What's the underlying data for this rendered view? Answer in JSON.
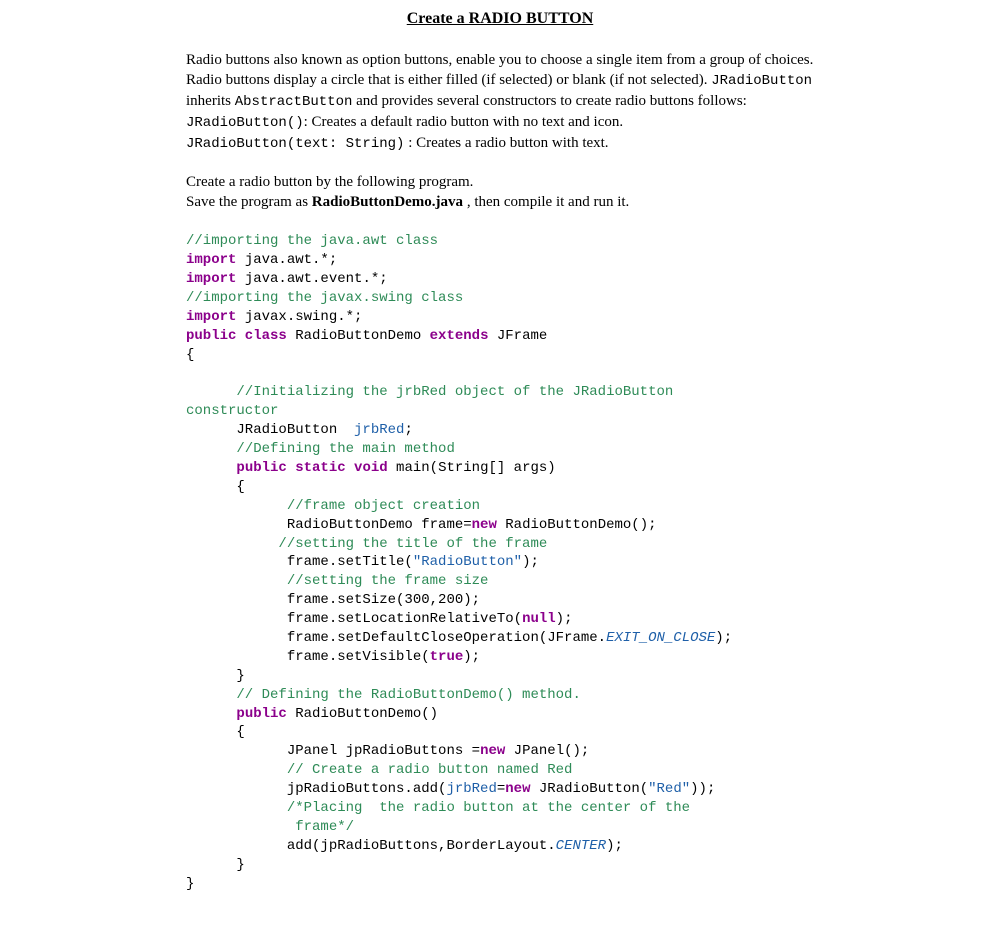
{
  "title": "Create a RADIO BUTTON",
  "intro": {
    "p1a": "Radio buttons also known as option buttons, enable you to choose a single item from a group of choices. Radio buttons display a circle that is either filled (if selected) or blank (if not selected). ",
    "p1_code1": "JRadioButton",
    "p1b": " inherits ",
    "p1_code2": "AbstractButton",
    "p1c": " and provides several constructors to create radio buttons follows:",
    "ctor1_sig": "JRadioButton()",
    "ctor1_desc": ": Creates a default radio button with no text and icon.",
    "ctor2_sig": "JRadioButton(text: String)",
    "ctor2_desc": " : Creates a radio button with text."
  },
  "instr": {
    "l1": "Create a radio button by the following program.",
    "l2a": "Save the program as ",
    "l2b": "RadioButtonDemo.java",
    "l2c": " , then compile it and run it."
  },
  "code": {
    "c01": "//importing the java.awt class",
    "c02a": "import",
    "c02b": " java.awt.*;",
    "c03a": "import",
    "c03b": " java.awt.event.*;",
    "c04": "//importing the javax.swing class",
    "c05a": "import",
    "c05b": " javax.swing.*;",
    "c06a": "public class",
    "c06b": " RadioButtonDemo ",
    "c06c": "extends",
    "c06d": " JFrame",
    "c07": "{",
    "c08": "      //Initializing the jrbRed object of the JRadioButton",
    "c08b": "constructor",
    "c09a": "      JRadioButton  ",
    "c09b": "jrbRed",
    "c09c": ";",
    "c10": "      //Defining the main method",
    "c11a": "      ",
    "c11b": "public static void",
    "c11c": " main(String[] args)",
    "c12": "      {",
    "c13": "            //frame object creation",
    "c14a": "            RadioButtonDemo frame=",
    "c14b": "new",
    "c14c": " RadioButtonDemo();",
    "c15": "           //setting the title of the frame",
    "c16a": "            frame.setTitle(",
    "c16b": "\"RadioButton\"",
    "c16c": ");",
    "c17": "            //setting the frame size",
    "c18": "            frame.setSize(300,200);",
    "c19a": "            frame.setLocationRelativeTo(",
    "c19b": "null",
    "c19c": ");",
    "c20a": "            frame.setDefaultCloseOperation(JFrame.",
    "c20b": "EXIT_ON_CLOSE",
    "c20c": ");",
    "c21a": "            frame.setVisible(",
    "c21b": "true",
    "c21c": ");",
    "c22": "      }",
    "c23": "      // Defining the RadioButtonDemo() method.",
    "c24a": "      ",
    "c24b": "public",
    "c24c": " RadioButtonDemo()",
    "c25": "      {",
    "c26a": "            JPanel jpRadioButtons =",
    "c26b": "new",
    "c26c": " JPanel();",
    "c27": "            // Create a radio button named Red",
    "c28a": "            jpRadioButtons.add(",
    "c28b": "jrbRed",
    "c28c": "=",
    "c28d": "new",
    "c28e": " JRadioButton(",
    "c28f": "\"Red\"",
    "c28g": "));",
    "c29": "            /*Placing  the radio button at the center of the",
    "c29b": "             frame*/",
    "c30a": "            add(jpRadioButtons,BorderLayout.",
    "c30b": "CENTER",
    "c30c": ");",
    "c31": "      }",
    "c32": "}"
  }
}
